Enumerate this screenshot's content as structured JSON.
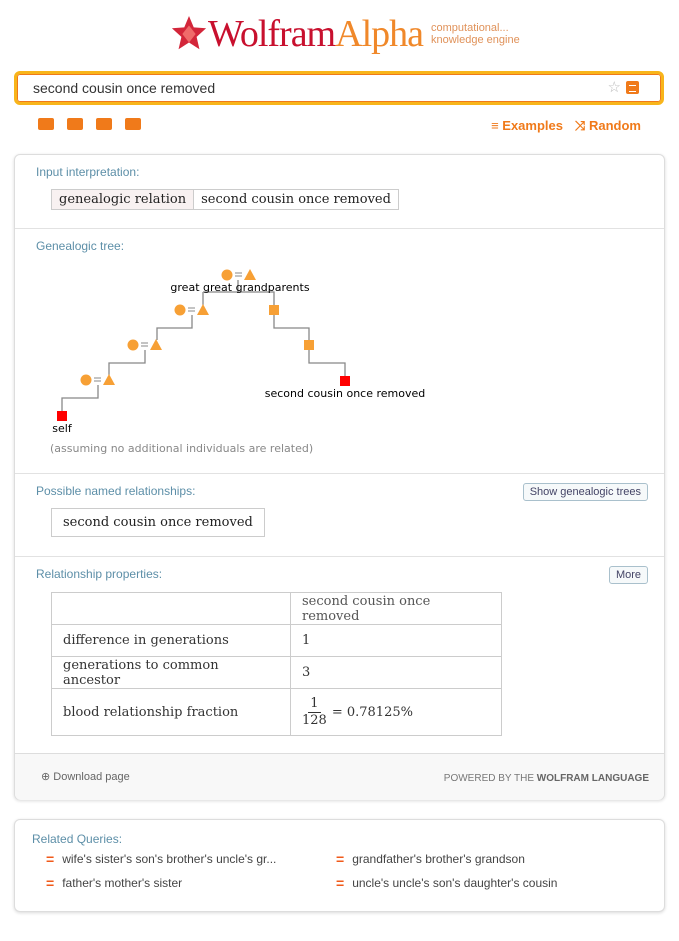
{
  "logo": {
    "word1": "Wolfram",
    "word2": "Alpha",
    "tagline1": "computational...",
    "tagline2": "knowledge engine"
  },
  "search": {
    "value": "second cousin once removed"
  },
  "toolbar": {
    "icons": [
      "keyboard-icon",
      "camera-icon",
      "list-icon",
      "upload-folder-icon"
    ],
    "examples": "≡ Examples",
    "random": "⤨ Random"
  },
  "pods": {
    "input": {
      "title": "Input interpretation:",
      "cells": [
        "genealogic relation",
        "second cousin once removed"
      ]
    },
    "tree": {
      "title": "Genealogic tree:",
      "top_label": "great great grandparents",
      "relative_label": "second cousin once removed",
      "self_label": "self",
      "note": "(assuming no additional individuals are related)",
      "colors": {
        "ancestor": "#f7a035",
        "highlight": "#ff0000"
      }
    },
    "named": {
      "title": "Possible named relationships:",
      "button": "Show genealogic trees",
      "value": "second cousin once removed"
    },
    "props": {
      "title": "Relationship properties:",
      "button": "More",
      "header": "second cousin once removed",
      "rows": [
        {
          "label": "difference in generations",
          "value": "1"
        },
        {
          "label": "generations to common ancestor",
          "value": "3"
        },
        {
          "label": "blood relationship fraction",
          "num": "1",
          "den": "128",
          "value": "= 0.78125%"
        }
      ]
    }
  },
  "footer": {
    "download": "Download page",
    "powered_prefix": "POWERED BY THE ",
    "powered_brand": "WOLFRAM LANGUAGE"
  },
  "related": {
    "title": "Related Queries:",
    "items": [
      "wife's sister's son's brother's uncle's gr...",
      "grandfather's brother's grandson",
      "father's mother's sister",
      "uncle's uncle's son's daughter's cousin"
    ]
  }
}
